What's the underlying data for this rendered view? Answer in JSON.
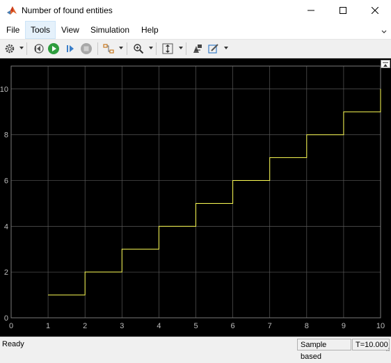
{
  "window": {
    "title": "Number of found entities"
  },
  "menu": {
    "items": [
      "File",
      "Tools",
      "View",
      "Simulation",
      "Help"
    ]
  },
  "toolbar": {
    "icons": [
      "gear-icon",
      "step-back-icon",
      "run-icon",
      "step-forward-icon",
      "stop-icon",
      "highlight-block-icon",
      "zoom-icon",
      "autoscale-icon",
      "signal-select-icon",
      "style-icon"
    ]
  },
  "status": {
    "left": "Ready",
    "mode": "Sample based",
    "time": "T=10.000"
  },
  "colors": {
    "line": "#ffff55",
    "plot_bg": "#000000",
    "grid": "#5a5a5a",
    "tick_text": "#bdbdbd"
  },
  "chart_data": {
    "type": "line",
    "step": true,
    "title": "",
    "xlabel": "",
    "ylabel": "",
    "xlim": [
      0,
      10
    ],
    "ylim": [
      0,
      11
    ],
    "xticks": [
      0,
      1,
      2,
      3,
      4,
      5,
      6,
      7,
      8,
      9,
      10
    ],
    "yticks": [
      0,
      2,
      4,
      6,
      8,
      10
    ],
    "grid": true,
    "series": [
      {
        "x": [
          1,
          2,
          2,
          3,
          3,
          4,
          4,
          5,
          5,
          6,
          6,
          7,
          7,
          8,
          8,
          9,
          9,
          10,
          10
        ],
        "y": [
          1,
          1,
          2,
          2,
          3,
          3,
          4,
          4,
          5,
          5,
          6,
          6,
          7,
          7,
          8,
          8,
          9,
          9,
          10
        ]
      }
    ]
  }
}
